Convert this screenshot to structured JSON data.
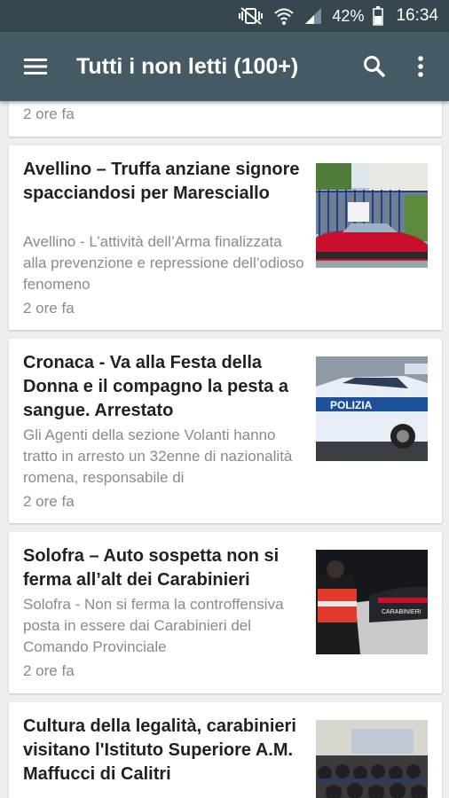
{
  "status_bar": {
    "battery": "42%",
    "time": "16:34",
    "icons": [
      "mute-vibrate-icon",
      "wifi-icon",
      "signal-icon",
      "battery-icon"
    ]
  },
  "app_bar": {
    "title": "Tutti i non letti (100+)",
    "icons": [
      "menu-icon",
      "search-icon",
      "more-vert-icon"
    ]
  },
  "articles": [
    {
      "time": "2 ore fa"
    },
    {
      "title": "Avellino – Truffa anziane signore spacciandosi per Maresciallo",
      "snippet": "Avellino -  L’attività dell’Arma finalizzata alla prevenzione e repressione dell’odioso fenomeno",
      "time": "2 ore fa"
    },
    {
      "title": "Cronaca - Va alla Festa della Donna e il compagno la pesta a sangue. Arrestato",
      "snippet": "Gli Agenti della sezione Volanti hanno tratto in arresto un 32enne di nazionalità romena, responsabile di",
      "time": "2 ore fa"
    },
    {
      "title": "Solofra – Auto sospetta non si ferma all’alt dei Carabinieri",
      "snippet": "Solofra -  Non si ferma la controffensiva posta in essere dai Carabinieri del Comando Provinciale",
      "time": "2 ore fa"
    },
    {
      "title": "Cultura della legalità, carabinieri visitano l'Istituto Superiore A.M. Maffucci di Calitri"
    }
  ],
  "thumb_text": {
    "police_car": "POLIZIA",
    "vest": "CARABINIERI"
  },
  "colors": {
    "app_bar": "#455a64",
    "status_bar": "#37474f",
    "background": "#eeeeee"
  }
}
